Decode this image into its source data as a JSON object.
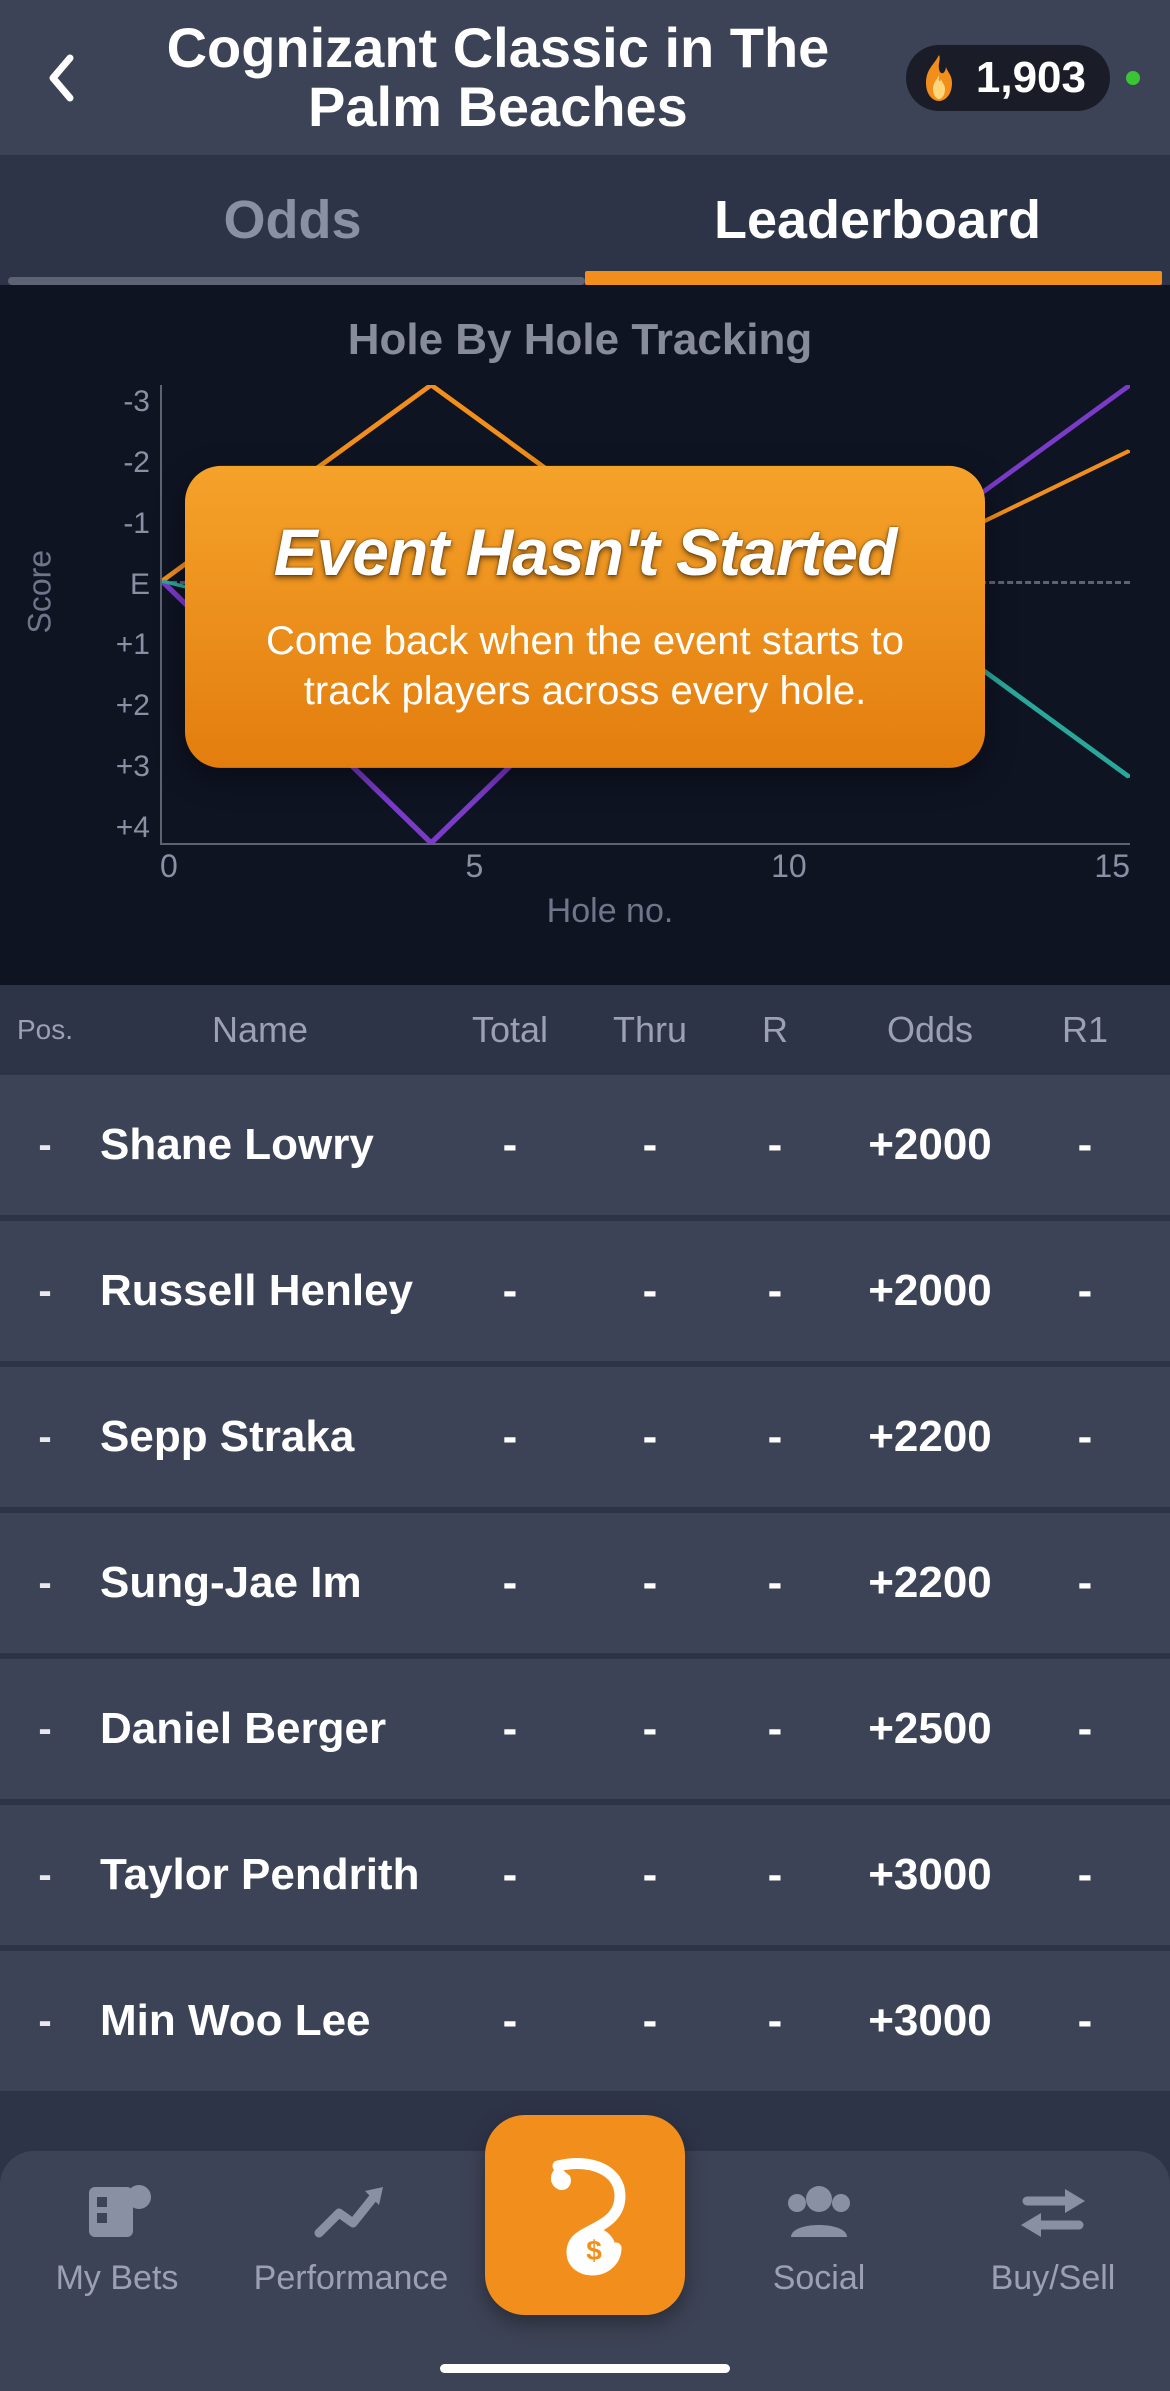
{
  "header": {
    "title": "Cognizant Classic in The Palm Beaches",
    "coin_count": "1,903"
  },
  "tabs": {
    "odds": "Odds",
    "leaderboard": "Leaderboard",
    "active": "leaderboard"
  },
  "chart": {
    "title": "Hole By Hole Tracking",
    "ylabel": "Score",
    "xlabel": "Hole no.",
    "yticks": [
      "-3",
      "-2",
      "-1",
      "E",
      "+1",
      "+2",
      "+3",
      "+4"
    ],
    "xticks": [
      "0",
      "5",
      "10",
      "15"
    ]
  },
  "overlay": {
    "title": "Event Hasn't Started",
    "subtitle": "Come back when the event starts to track players across every hole."
  },
  "table": {
    "columns": {
      "pos": "Pos.",
      "name": "Name",
      "total": "Total",
      "thru": "Thru",
      "r": "R",
      "odds": "Odds",
      "r1": "R1"
    },
    "rows": [
      {
        "pos": "-",
        "name": "Shane Lowry",
        "total": "-",
        "thru": "-",
        "r": "-",
        "odds": "+2000",
        "r1": "-"
      },
      {
        "pos": "-",
        "name": "Russell Henley",
        "total": "-",
        "thru": "-",
        "r": "-",
        "odds": "+2000",
        "r1": "-"
      },
      {
        "pos": "-",
        "name": "Sepp Straka",
        "total": "-",
        "thru": "-",
        "r": "-",
        "odds": "+2200",
        "r1": "-"
      },
      {
        "pos": "-",
        "name": "Sung-Jae Im",
        "total": "-",
        "thru": "-",
        "r": "-",
        "odds": "+2200",
        "r1": "-"
      },
      {
        "pos": "-",
        "name": "Daniel Berger",
        "total": "-",
        "thru": "-",
        "r": "-",
        "odds": "+2500",
        "r1": "-"
      },
      {
        "pos": "-",
        "name": "Taylor Pendrith",
        "total": "-",
        "thru": "-",
        "r": "-",
        "odds": "+3000",
        "r1": "-"
      },
      {
        "pos": "-",
        "name": "Min Woo Lee",
        "total": "-",
        "thru": "-",
        "r": "-",
        "odds": "+3000",
        "r1": "-"
      }
    ]
  },
  "nav": {
    "mybets": "My Bets",
    "performance": "Performance",
    "social": "Social",
    "buysell": "Buy/Sell"
  },
  "chart_data": {
    "type": "line",
    "title": "Hole By Hole Tracking",
    "xlabel": "Hole no.",
    "ylabel": "Score",
    "xlim": [
      0,
      18
    ],
    "ylim_top_to_bottom": [
      -3,
      4
    ],
    "yticks": [
      -3,
      -2,
      -1,
      0,
      1,
      2,
      3,
      4
    ],
    "xticks": [
      0,
      5,
      10,
      15
    ],
    "series": [
      {
        "name": "orange",
        "color": "#f28f1c",
        "points": [
          [
            0,
            0
          ],
          [
            5,
            -3
          ],
          [
            10,
            0
          ],
          [
            13,
            0
          ],
          [
            18,
            -2
          ]
        ]
      },
      {
        "name": "purple",
        "color": "#7a3bc9",
        "points": [
          [
            0,
            0
          ],
          [
            5,
            4
          ],
          [
            10,
            0
          ],
          [
            13,
            0
          ],
          [
            18,
            -3
          ]
        ]
      },
      {
        "name": "teal",
        "color": "#2aa79b",
        "points": [
          [
            0,
            0
          ],
          [
            5,
            1
          ],
          [
            10,
            -1
          ],
          [
            13,
            0
          ],
          [
            18,
            3
          ]
        ]
      }
    ]
  }
}
